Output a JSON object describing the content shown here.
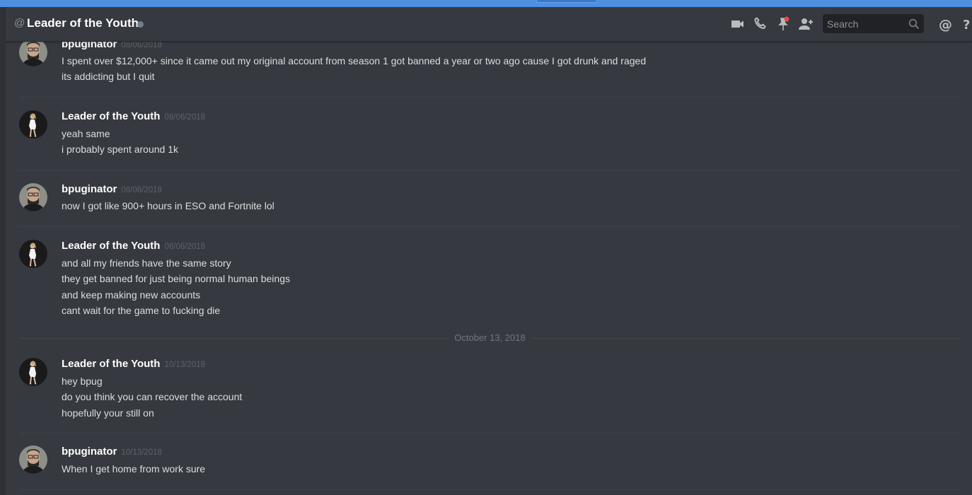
{
  "header": {
    "channel_name": "Leader of the Youth",
    "at_symbol": "@",
    "search_placeholder": "Search",
    "icons": [
      "video-call-icon",
      "voice-call-icon",
      "pinned-messages-icon",
      "add-friend-icon",
      "search-icon",
      "mentions-icon",
      "help-icon"
    ]
  },
  "messages": [
    {
      "author": "bpuginator",
      "timestamp": "08/06/2018",
      "lines": [
        "I spent over $12,000+ since it came out my original account from season 1 got banned a year or two ago cause I got drunk and raged",
        "its addicting but I quit"
      ]
    },
    {
      "author": "Leader of the Youth",
      "timestamp": "08/06/2018",
      "lines": [
        "yeah same",
        "i probably spent around 1k"
      ]
    },
    {
      "author": "bpuginator",
      "timestamp": "08/06/2018",
      "lines": [
        "now I got like 900+ hours in ESO and Fortnite lol"
      ]
    },
    {
      "author": "Leader of the Youth",
      "timestamp": "08/06/2018",
      "lines": [
        "and all my friends have the same story",
        "they get banned for just being normal human beings",
        "and keep making new accounts",
        "cant wait for the game to fucking die"
      ]
    },
    {
      "author": "Leader of the Youth",
      "timestamp": "10/13/2018",
      "lines": [
        "hey bpug",
        "do you think you can recover the account",
        "hopefully your still on"
      ]
    },
    {
      "author": "bpuginator",
      "timestamp": "10/13/2018",
      "lines": [
        "When I get home from work sure"
      ]
    }
  ],
  "date_divider": "October 13, 2018",
  "colors": {
    "background": "#36393f",
    "header_accent": "#4f8fe0",
    "notification_dot": "#f04747",
    "status_offline": "#747f8d"
  }
}
